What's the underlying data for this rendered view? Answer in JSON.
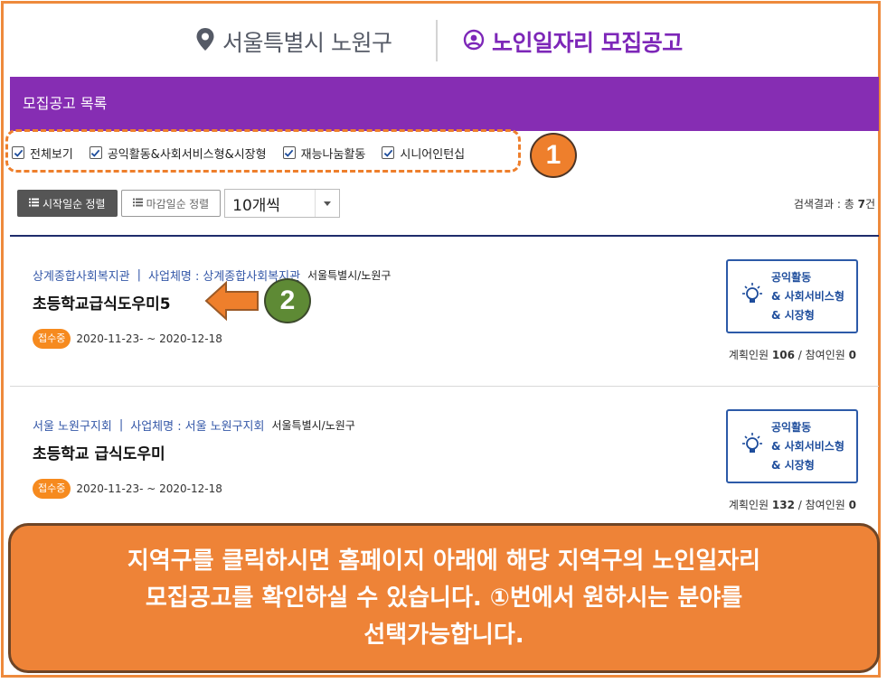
{
  "header": {
    "location": "서울특별시 노원구",
    "page_title": "노인일자리 모집공고"
  },
  "list_header": "모집공고 목록",
  "filters": [
    {
      "label": "전체보기",
      "checked": true
    },
    {
      "label": "공익활동&사회서비스형&시장형",
      "checked": true
    },
    {
      "label": "재능나눔활동",
      "checked": true
    },
    {
      "label": "시니어인턴십",
      "checked": true
    }
  ],
  "badges": {
    "one": "1",
    "two": "2"
  },
  "sort": {
    "start_label": "시작일순 정렬",
    "end_label": "마감일순 정렬",
    "per_page": "10개씩"
  },
  "result": {
    "prefix": "검색결과 : 총",
    "count": "7",
    "suffix": "건"
  },
  "jobs": [
    {
      "org": "상계종합사회복지관",
      "business_label": "사업체명 :",
      "business_name": "상계종합사회복지관",
      "region": "서울특별시/노원구",
      "title": "초등학교급식도우미5",
      "status": "접수중",
      "dates": "2020-11-23- ~ 2020-12-18",
      "type_lines": [
        "공익활동",
        "& 사회서비스형",
        "& 시장형"
      ],
      "plan_label": "계획인원",
      "plan": "106",
      "participate_label": "참여인원",
      "participate": "0"
    },
    {
      "org": "서울 노원구지회",
      "business_label": "사업체명 :",
      "business_name": "서울 노원구지회",
      "region": "서울특별시/노원구",
      "title": "초등학교 급식도우미",
      "status": "접수중",
      "dates": "2020-11-23- ~ 2020-12-18",
      "type_lines": [
        "공익활동",
        "& 사회서비스형",
        "& 시장형"
      ],
      "plan_label": "계획인원",
      "plan": "132",
      "participate_label": "참여인원",
      "participate": "0"
    }
  ],
  "overlay": {
    "line1": "지역구를 클릭하시면 홈페이지 아래에 해당 지역구의 노인일자리",
    "line2": "모집공고를 확인하실 수 있습니다. ①번에서 원하시는 분야를",
    "line3": "선택가능합니다."
  },
  "colors": {
    "purple": "#862db3",
    "accent_orange": "#ee7f2c",
    "navy": "#1e2c6c",
    "link_blue": "#3558a8"
  }
}
